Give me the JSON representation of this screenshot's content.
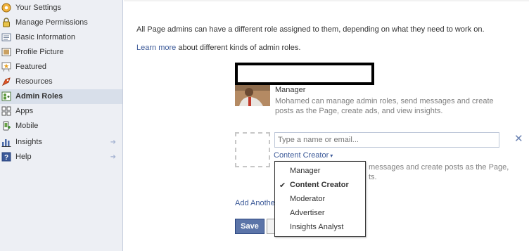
{
  "sidebar": {
    "items": [
      {
        "label": "Your Settings",
        "icon": "settings-icon"
      },
      {
        "label": "Manage Permissions",
        "icon": "lock-icon"
      },
      {
        "label": "Basic Information",
        "icon": "info-card-icon"
      },
      {
        "label": "Profile Picture",
        "icon": "picture-icon"
      },
      {
        "label": "Featured",
        "icon": "star-board-icon"
      },
      {
        "label": "Resources",
        "icon": "resources-icon"
      },
      {
        "label": "Admin Roles",
        "icon": "admin-roles-icon",
        "active": true
      },
      {
        "label": "Apps",
        "icon": "apps-icon"
      },
      {
        "label": "Mobile",
        "icon": "mobile-icon"
      },
      {
        "label": "Insights",
        "icon": "insights-icon",
        "arrow": "➜"
      },
      {
        "label": "Help",
        "icon": "help-icon",
        "arrow": "➜"
      }
    ]
  },
  "main": {
    "intro_text": "All Page admins can have a different role assigned to them, depending on what they need to work on.",
    "learn_more_link": "Learn more",
    "learn_more_rest": " about different kinds of admin roles.",
    "existing_admin": {
      "role": "Manager",
      "description_line1": "Mohamed can manage admin roles, send messages and create",
      "description_line2": "posts as the Page, create ads, and view insights."
    },
    "new_admin": {
      "input_placeholder": "Type a name or email...",
      "input_value": "",
      "selected_role": "Content Creator",
      "caret": "▾",
      "close_glyph": "✕",
      "description_line1": "messages and create posts as the Page,",
      "description_line2": "ts."
    },
    "add_another": "Add Another",
    "save_label": "Save",
    "cancel_label": "C"
  },
  "role_dropdown": {
    "check_glyph": "✔",
    "options": [
      {
        "label": "Manager",
        "selected": false
      },
      {
        "label": "Content Creator",
        "selected": true
      },
      {
        "label": "Moderator",
        "selected": false
      },
      {
        "label": "Advertiser",
        "selected": false
      },
      {
        "label": "Insights Analyst",
        "selected": false
      }
    ]
  },
  "colors": {
    "sidebar_bg": "#edeff4",
    "active_bg": "#d8dfea",
    "link": "#3b5998",
    "save_button": "#5b74a8"
  }
}
